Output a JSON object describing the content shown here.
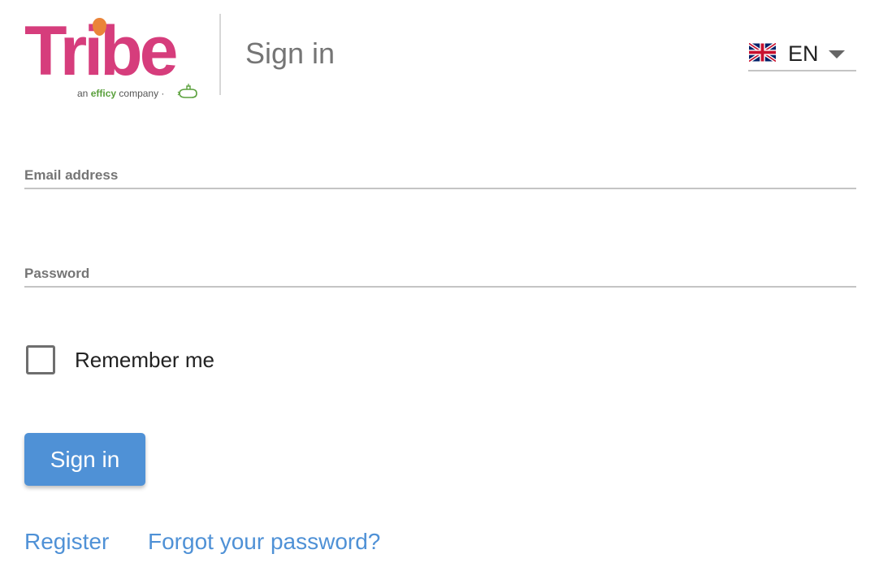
{
  "logo": {
    "wordmark": "Tribe",
    "tagline_prefix": "an",
    "tagline_brand": "efficy",
    "tagline_suffix": "company ·",
    "brand_color": "#d63d7c",
    "accent_dot_color": "#ea8439",
    "efficy_color": "#5aa03c"
  },
  "header": {
    "title": "Sign in"
  },
  "language": {
    "flag_icon": "uk-flag-icon",
    "selected": "EN"
  },
  "form": {
    "email_label": "Email address",
    "email_value": "",
    "password_label": "Password",
    "password_value": "",
    "remember_label": "Remember me",
    "remember_checked": false,
    "submit_label": "Sign in"
  },
  "links": {
    "register": "Register",
    "forgot_password": "Forgot your password?"
  },
  "colors": {
    "primary": "#4f91d6",
    "label_gray": "#757575",
    "underline": "#c4c4c4"
  }
}
